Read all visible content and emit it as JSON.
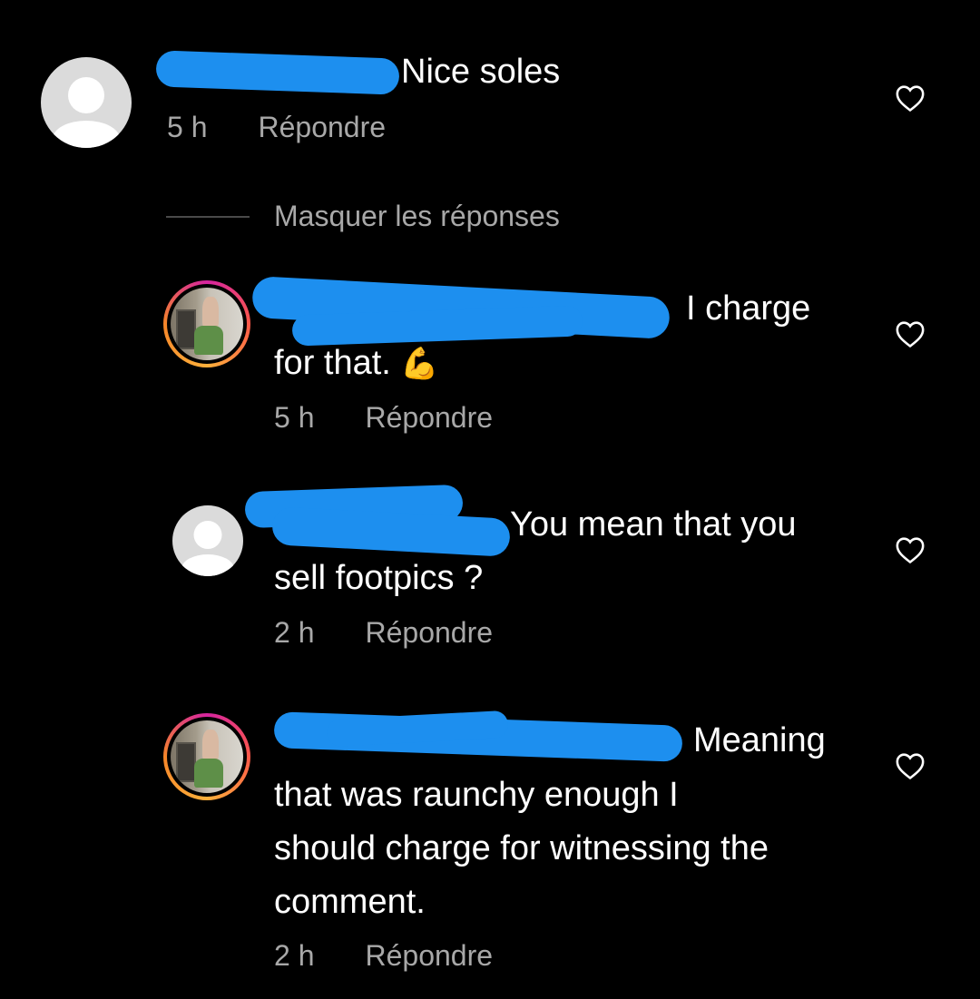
{
  "comments": [
    {
      "text_lines": [
        "Nice soles"
      ],
      "time": "5 h",
      "reply_label": "Répondre"
    },
    {
      "text_lines": [
        "I charge",
        "for that."
      ],
      "emoji": "💪",
      "time": "5 h",
      "reply_label": "Répondre"
    },
    {
      "text_lines": [
        "You mean that you",
        "sell footpics ?"
      ],
      "time": "2 h",
      "reply_label": "Répondre"
    },
    {
      "text_lines": [
        "Meaning",
        "that was raunchy enough I",
        "should charge for witnessing the",
        "comment."
      ],
      "time": "2 h",
      "reply_label": "Répondre"
    }
  ],
  "hide_replies_label": "Masquer les réponses",
  "colors": {
    "background": "#000000",
    "text": "#ffffff",
    "secondary": "#a8a8a8",
    "redaction": "#1d8fef"
  },
  "icons": {
    "like": "heart-outline-icon",
    "avatar_default": "default-avatar-icon"
  }
}
